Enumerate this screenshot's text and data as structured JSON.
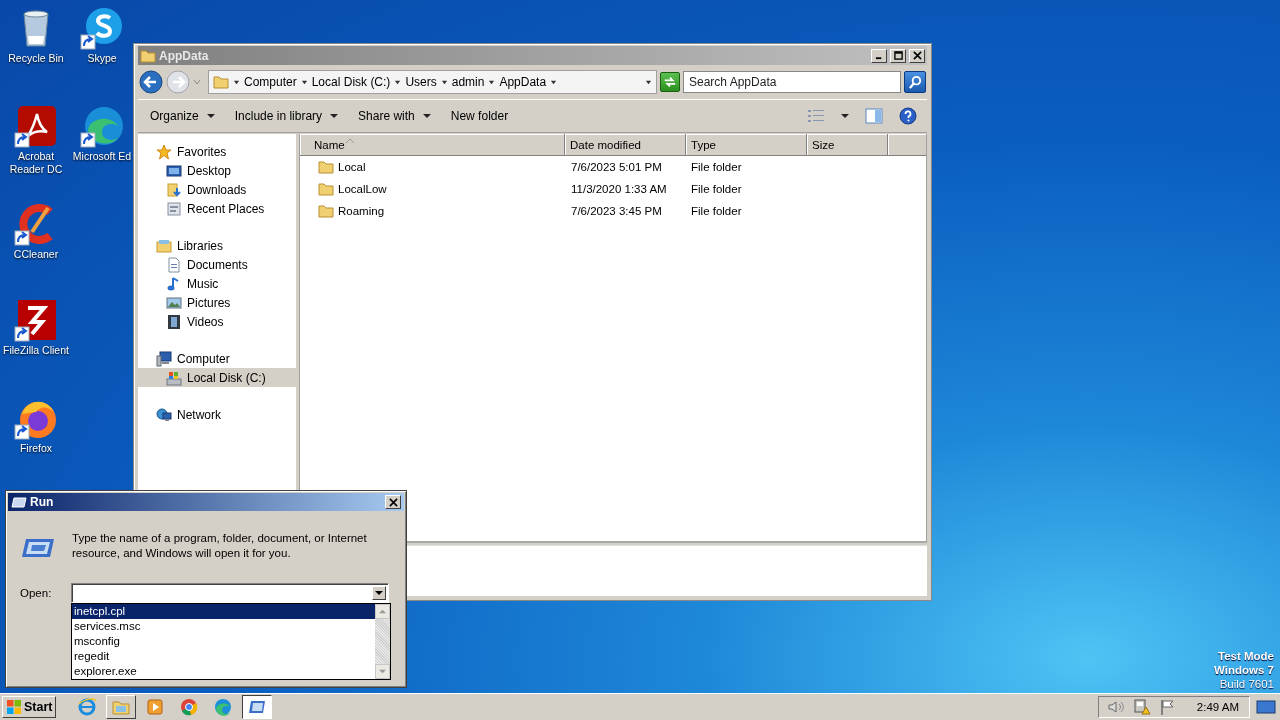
{
  "desktop": {
    "icons": [
      {
        "label": "Recycle Bin",
        "kind": "recycle",
        "shortcut": false
      },
      {
        "label": "Skype",
        "kind": "skype",
        "shortcut": true
      },
      {
        "label": "Acrobat Reader DC",
        "kind": "acrobat",
        "shortcut": true
      },
      {
        "label": "Microsoft Ed",
        "kind": "edge",
        "shortcut": true
      },
      {
        "label": "CCleaner",
        "kind": "ccleaner",
        "shortcut": true
      },
      {
        "label": "FileZilla Client",
        "kind": "filezilla",
        "shortcut": true
      },
      {
        "label": "Firefox",
        "kind": "firefox",
        "shortcut": true
      }
    ],
    "notice": [
      "Test Mode",
      "Windows 7",
      "Build 7601"
    ]
  },
  "explorer": {
    "title": "AppData",
    "breadcrumbs": [
      "Computer",
      "Local Disk (C:)",
      "Users",
      "admin",
      "AppData"
    ],
    "search": {
      "placeholder": "Search AppData"
    },
    "toolbar": [
      {
        "label": "Organize",
        "has_menu": true
      },
      {
        "label": "Include in library",
        "has_menu": true
      },
      {
        "label": "Share with",
        "has_menu": true
      },
      {
        "label": "New folder",
        "has_menu": false
      }
    ],
    "nav": [
      {
        "label": "Favorites",
        "kind": "favorites",
        "selected": false,
        "children": [
          {
            "label": "Desktop",
            "kind": "desktop",
            "selected": false
          },
          {
            "label": "Downloads",
            "kind": "downloads",
            "selected": false
          },
          {
            "label": "Recent Places",
            "kind": "recent",
            "selected": false
          }
        ]
      },
      {
        "label": "Libraries",
        "kind": "libraries",
        "selected": false,
        "children": [
          {
            "label": "Documents",
            "kind": "documents",
            "selected": false
          },
          {
            "label": "Music",
            "kind": "music",
            "selected": false
          },
          {
            "label": "Pictures",
            "kind": "pictures",
            "selected": false
          },
          {
            "label": "Videos",
            "kind": "videos",
            "selected": false
          }
        ]
      },
      {
        "label": "Computer",
        "kind": "computer",
        "selected": false,
        "children": [
          {
            "label": "Local Disk (C:)",
            "kind": "drive",
            "selected": true
          }
        ]
      },
      {
        "label": "Network",
        "kind": "network",
        "selected": false
      }
    ],
    "columns": [
      {
        "label": "Name",
        "sorted": true
      },
      {
        "label": "Date modified",
        "sorted": false
      },
      {
        "label": "Type",
        "sorted": false
      },
      {
        "label": "Size",
        "sorted": false
      }
    ],
    "rows": [
      {
        "name": "Local",
        "date": "7/6/2023 5:01 PM",
        "type": "File folder"
      },
      {
        "name": "LocalLow",
        "date": "11/3/2020 1:33 AM",
        "type": "File folder"
      },
      {
        "name": "Roaming",
        "date": "7/6/2023 3:45 PM",
        "type": "File folder"
      }
    ]
  },
  "run_dialog": {
    "title": "Run",
    "message": "Type the name of a program, folder, document, or Internet resource, and Windows will open it for you.",
    "open_label": "Open:",
    "history": [
      {
        "label": "inetcpl.cpl",
        "selected": true
      },
      {
        "label": "services.msc",
        "selected": false
      },
      {
        "label": "msconfig",
        "selected": false
      },
      {
        "label": "regedit",
        "selected": false
      },
      {
        "label": "explorer.exe",
        "selected": false
      }
    ]
  },
  "taskbar": {
    "start": "Start",
    "apps": [
      {
        "kind": "ie",
        "running": false,
        "active": false
      },
      {
        "kind": "explorer",
        "running": true,
        "active": false
      },
      {
        "kind": "media",
        "running": false,
        "active": false
      },
      {
        "kind": "chrome",
        "running": false,
        "active": false
      },
      {
        "kind": "edge",
        "running": false,
        "active": false
      },
      {
        "kind": "run",
        "running": true,
        "active": true
      }
    ],
    "clock": "2:49 AM"
  }
}
